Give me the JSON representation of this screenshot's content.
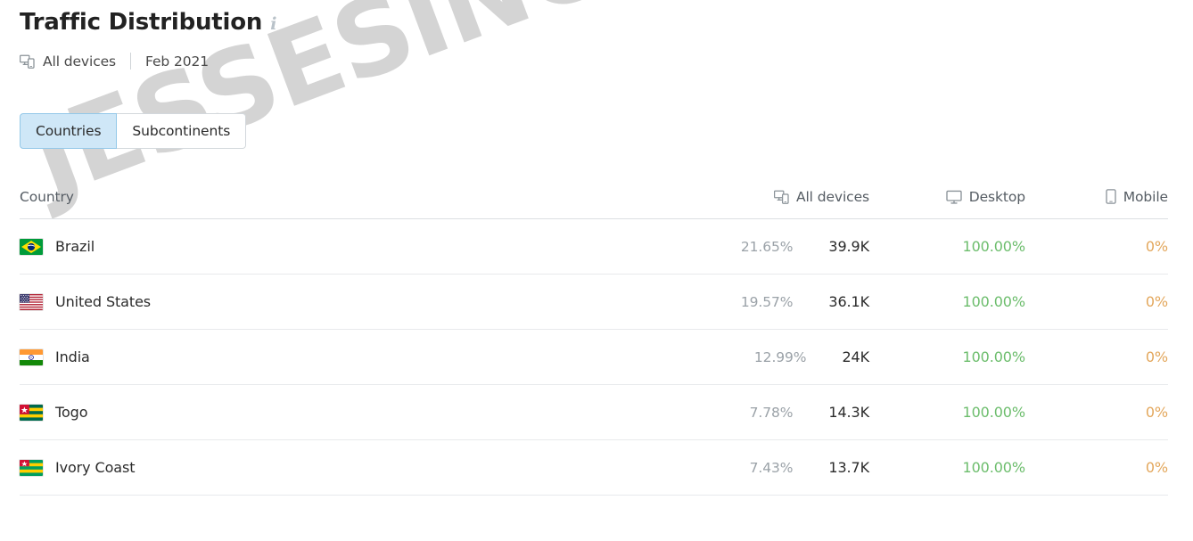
{
  "header": {
    "title": "Traffic Distribution",
    "info_icon": "info-icon",
    "device_icon": "all-devices-icon",
    "device_label": "All devices",
    "date_label": "Feb 2021"
  },
  "tabs": [
    {
      "label": "Countries",
      "active": true
    },
    {
      "label": "Subcontinents",
      "active": false
    }
  ],
  "table": {
    "columns": [
      {
        "key": "country",
        "label": "Country",
        "icon": null
      },
      {
        "key": "all",
        "label": "All devices",
        "icon": "all-devices-icon"
      },
      {
        "key": "desktop",
        "label": "Desktop",
        "icon": "desktop-icon"
      },
      {
        "key": "mobile",
        "label": "Mobile",
        "icon": "mobile-icon"
      }
    ],
    "rows": [
      {
        "country": "Brazil",
        "flag": "flag-brazil",
        "share": "21.65%",
        "traffic": "39.9K",
        "desktop": "100.00%",
        "mobile": "0%"
      },
      {
        "country": "United States",
        "flag": "flag-united-states",
        "share": "19.57%",
        "traffic": "36.1K",
        "desktop": "100.00%",
        "mobile": "0%"
      },
      {
        "country": "India",
        "flag": "flag-india",
        "share": "12.99%",
        "traffic": "24K",
        "desktop": "100.00%",
        "mobile": "0%"
      },
      {
        "country": "Togo",
        "flag": "flag-togo",
        "share": "7.78%",
        "traffic": "14.3K",
        "desktop": "100.00%",
        "mobile": "0%"
      },
      {
        "country": "Ivory Coast",
        "flag": "flag-ivory-coast",
        "share": "7.43%",
        "traffic": "13.7K",
        "desktop": "100.00%",
        "mobile": "0%"
      }
    ]
  },
  "watermark": {
    "text": "JESSESINGH.ORG"
  },
  "colors": {
    "green": "#6cbd6c",
    "orange": "#e3a75c",
    "muted": "#9ba2a8",
    "tab_active_bg": "#cfe7f7",
    "tab_active_border": "#93c8e8",
    "watermark": "#d4d4d4"
  }
}
